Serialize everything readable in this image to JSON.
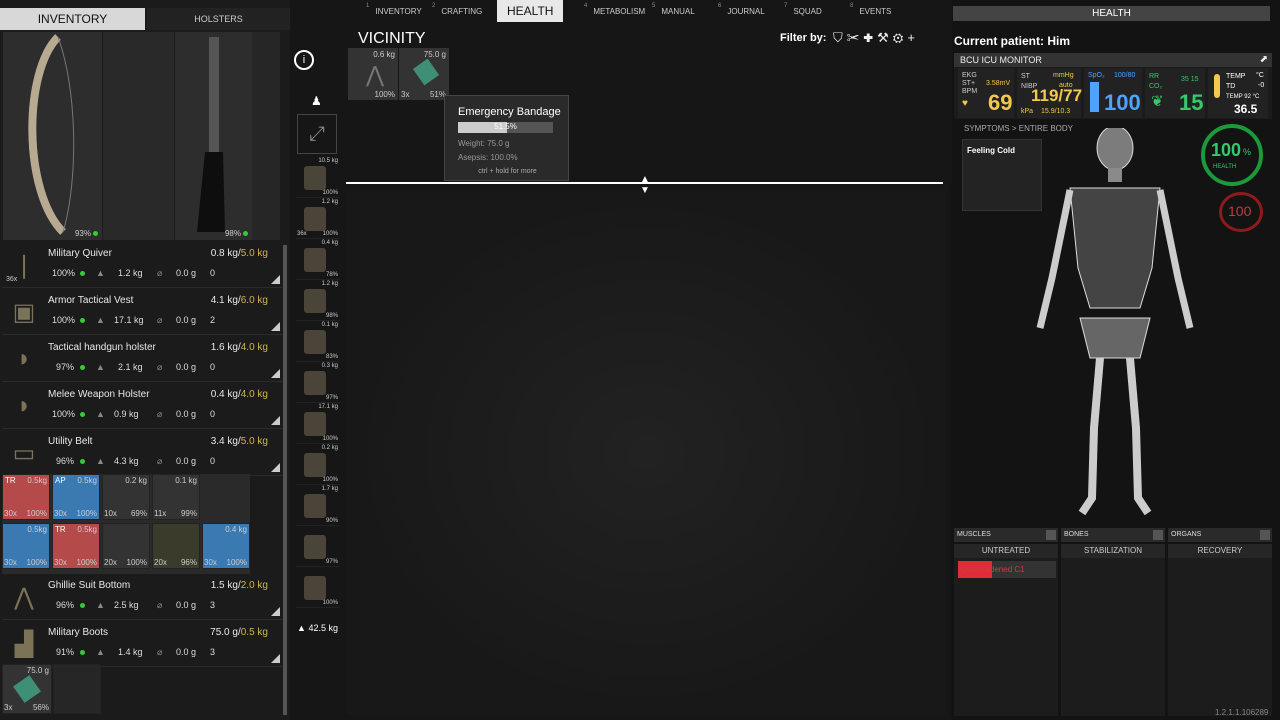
{
  "left": {
    "tab_active": "INVENTORY",
    "tab_inactive": "HOLSTERS",
    "weapon_conditions": [
      "93%",
      "98%"
    ],
    "items": [
      {
        "name": "Military Quiver",
        "weight": "0.8 kg/",
        "cap": "5.0 kg",
        "cond": "100%",
        "w2": "1.2 kg",
        "w3": "0.0 g",
        "n": "0",
        "badge": "36x",
        "icon": "quiver-icon"
      },
      {
        "name": "Armor Tactical Vest",
        "weight": "4.1 kg/",
        "cap": "6.0 kg",
        "cond": "100%",
        "w2": "17.1 kg",
        "w3": "0.0 g",
        "n": "2",
        "icon": "vest-icon"
      },
      {
        "name": "Tactical handgun holster",
        "weight": "1.6 kg/",
        "cap": "4.0 kg",
        "cond": "97%",
        "w2": "2.1 kg",
        "w3": "0.0 g",
        "n": "0",
        "icon": "holster-icon"
      },
      {
        "name": "Melee Weapon Holster",
        "weight": "0.4 kg/",
        "cap": "4.0 kg",
        "cond": "100%",
        "w2": "0.9 kg",
        "w3": "0.0 g",
        "n": "0",
        "icon": "holster-icon"
      },
      {
        "name": "Utility Belt",
        "weight": "3.4 kg/",
        "cap": "5.0 kg",
        "cond": "96%",
        "w2": "4.3 kg",
        "w3": "0.0 g",
        "n": "0",
        "icon": "belt-icon"
      }
    ],
    "grid_row1": [
      {
        "tl": "TR",
        "tr": "0.5kg",
        "bl": "30x",
        "br": "100%"
      },
      {
        "tl": "AP",
        "tr": "0.5kg",
        "bl": "30x",
        "br": "100%"
      },
      {
        "tl": "",
        "tr": "0.2 kg",
        "bl": "10x",
        "br": "69%"
      },
      {
        "tl": "",
        "tr": "0.1 kg",
        "bl": "11x",
        "br": "99%"
      }
    ],
    "grid_row2": [
      {
        "tl": "",
        "tr": "0.5kg",
        "bl": "30x",
        "br": "100%"
      },
      {
        "tl": "TR",
        "tr": "0.5kg",
        "bl": "30x",
        "br": "100%"
      },
      {
        "tl": "",
        "tr": "",
        "bl": "20x",
        "br": "100%"
      },
      {
        "tl": "",
        "tr": "",
        "bl": "20x",
        "br": "96%"
      },
      {
        "tl": "",
        "tr": "0.4 kg",
        "bl": "30x",
        "br": "100%"
      }
    ],
    "items2": [
      {
        "name": "Ghillie Suit Bottom",
        "weight": "1.5 kg/",
        "cap": "2.0 kg",
        "cond": "96%",
        "w2": "2.5 kg",
        "w3": "0.0 g",
        "n": "3",
        "icon": "pants-icon"
      },
      {
        "name": "Military Boots",
        "weight": "75.0 g/",
        "cap": "0.5 kg",
        "cond": "91%",
        "w2": "1.4 kg",
        "w3": "0.0 g",
        "n": "3",
        "icon": "boots-icon"
      }
    ],
    "bottom_slot": {
      "tr": "75.0 g",
      "bl": "3x",
      "br": "56%"
    }
  },
  "menu": [
    {
      "num": "1",
      "label": "INVENTORY"
    },
    {
      "num": "2",
      "label": "CRAFTING"
    },
    {
      "num": "3",
      "label": "HEALTH"
    },
    {
      "num": "4",
      "label": "METABOLISM"
    },
    {
      "num": "5",
      "label": "MANUAL"
    },
    {
      "num": "6",
      "label": "JOURNAL"
    },
    {
      "num": "7",
      "label": "SQUAD"
    },
    {
      "num": "8",
      "label": "EVENTS"
    }
  ],
  "vicinity": {
    "title": "VICINITY",
    "filter": "Filter by:",
    "slots": [
      {
        "tr": "0.6 kg",
        "br": "100%"
      },
      {
        "tr": "75.0 g",
        "bl": "3x",
        "br": "51%"
      }
    ]
  },
  "tooltip": {
    "title": "Emergency Bandage",
    "bar_value": "51.5%",
    "bar_fraction": 0.515,
    "weight": "Weight:  75.0 g",
    "asepsis": "Asepsis:  100.0%",
    "hint": "ctrl + hold for more"
  },
  "side_column": [
    {
      "w": "10.5 kg",
      "c": "100%"
    },
    {
      "w": "1.2 kg",
      "c": "100%",
      "b": "36x"
    },
    {
      "w": "0.4 kg",
      "c": "78%"
    },
    {
      "w": "1.2 kg",
      "c": "98%"
    },
    {
      "w": "0.1 kg",
      "c": "83%"
    },
    {
      "w": "0.3 kg",
      "c": "97%"
    },
    {
      "w": "17.1 kg",
      "c": "100%"
    },
    {
      "w": "0.2 kg",
      "c": "100%"
    },
    {
      "w": "1.7 kg",
      "c": "90%"
    },
    {
      "w": "",
      "c": "97%"
    },
    {
      "w": "",
      "c": "100%"
    }
  ],
  "total_weight": "42.5 kg",
  "health": {
    "header": "HEALTH",
    "patient": "Current patient: Him",
    "monitor": "BCU ICU MONITOR",
    "ekg_label": "EKG\nST+\nBPM",
    "ekg_mv": "3.58mV",
    "bpm": "69",
    "nibp_label": "ST\nNIBP",
    "nibp_unit": "mmHg",
    "nibp_auto": "auto",
    "nibp": "119/77",
    "nibp_kpa": "kPa",
    "nibp_sub": "15.9/10.3",
    "spo2_label": "SpO₂",
    "spo2_range": "100/80",
    "spo2": "100",
    "rr_label": "RR\nCO₂",
    "rr_range": "35 15",
    "rr": "15",
    "temp_label": "TEMP\nTD",
    "temp_unit": "°C",
    "temp_td": "-0",
    "temp_sub": "TEMP 92 °C",
    "temp": "36.5",
    "symptoms_header": "SYMPTOMS > ENTIRE BODY",
    "symptom": "Feeling Cold",
    "health_value": "100",
    "health_pct": "%",
    "health_label": "HEALTH",
    "blood_value": "100",
    "tabs": [
      "MUSCLES",
      "BONES",
      "ORGANS"
    ],
    "stages": [
      "UNTREATED",
      "STABILIZATION",
      "RECOVERY"
    ],
    "condition": "Overburdened C1",
    "condition_fraction": 0.35,
    "version": "1.2.1.1.106289"
  }
}
